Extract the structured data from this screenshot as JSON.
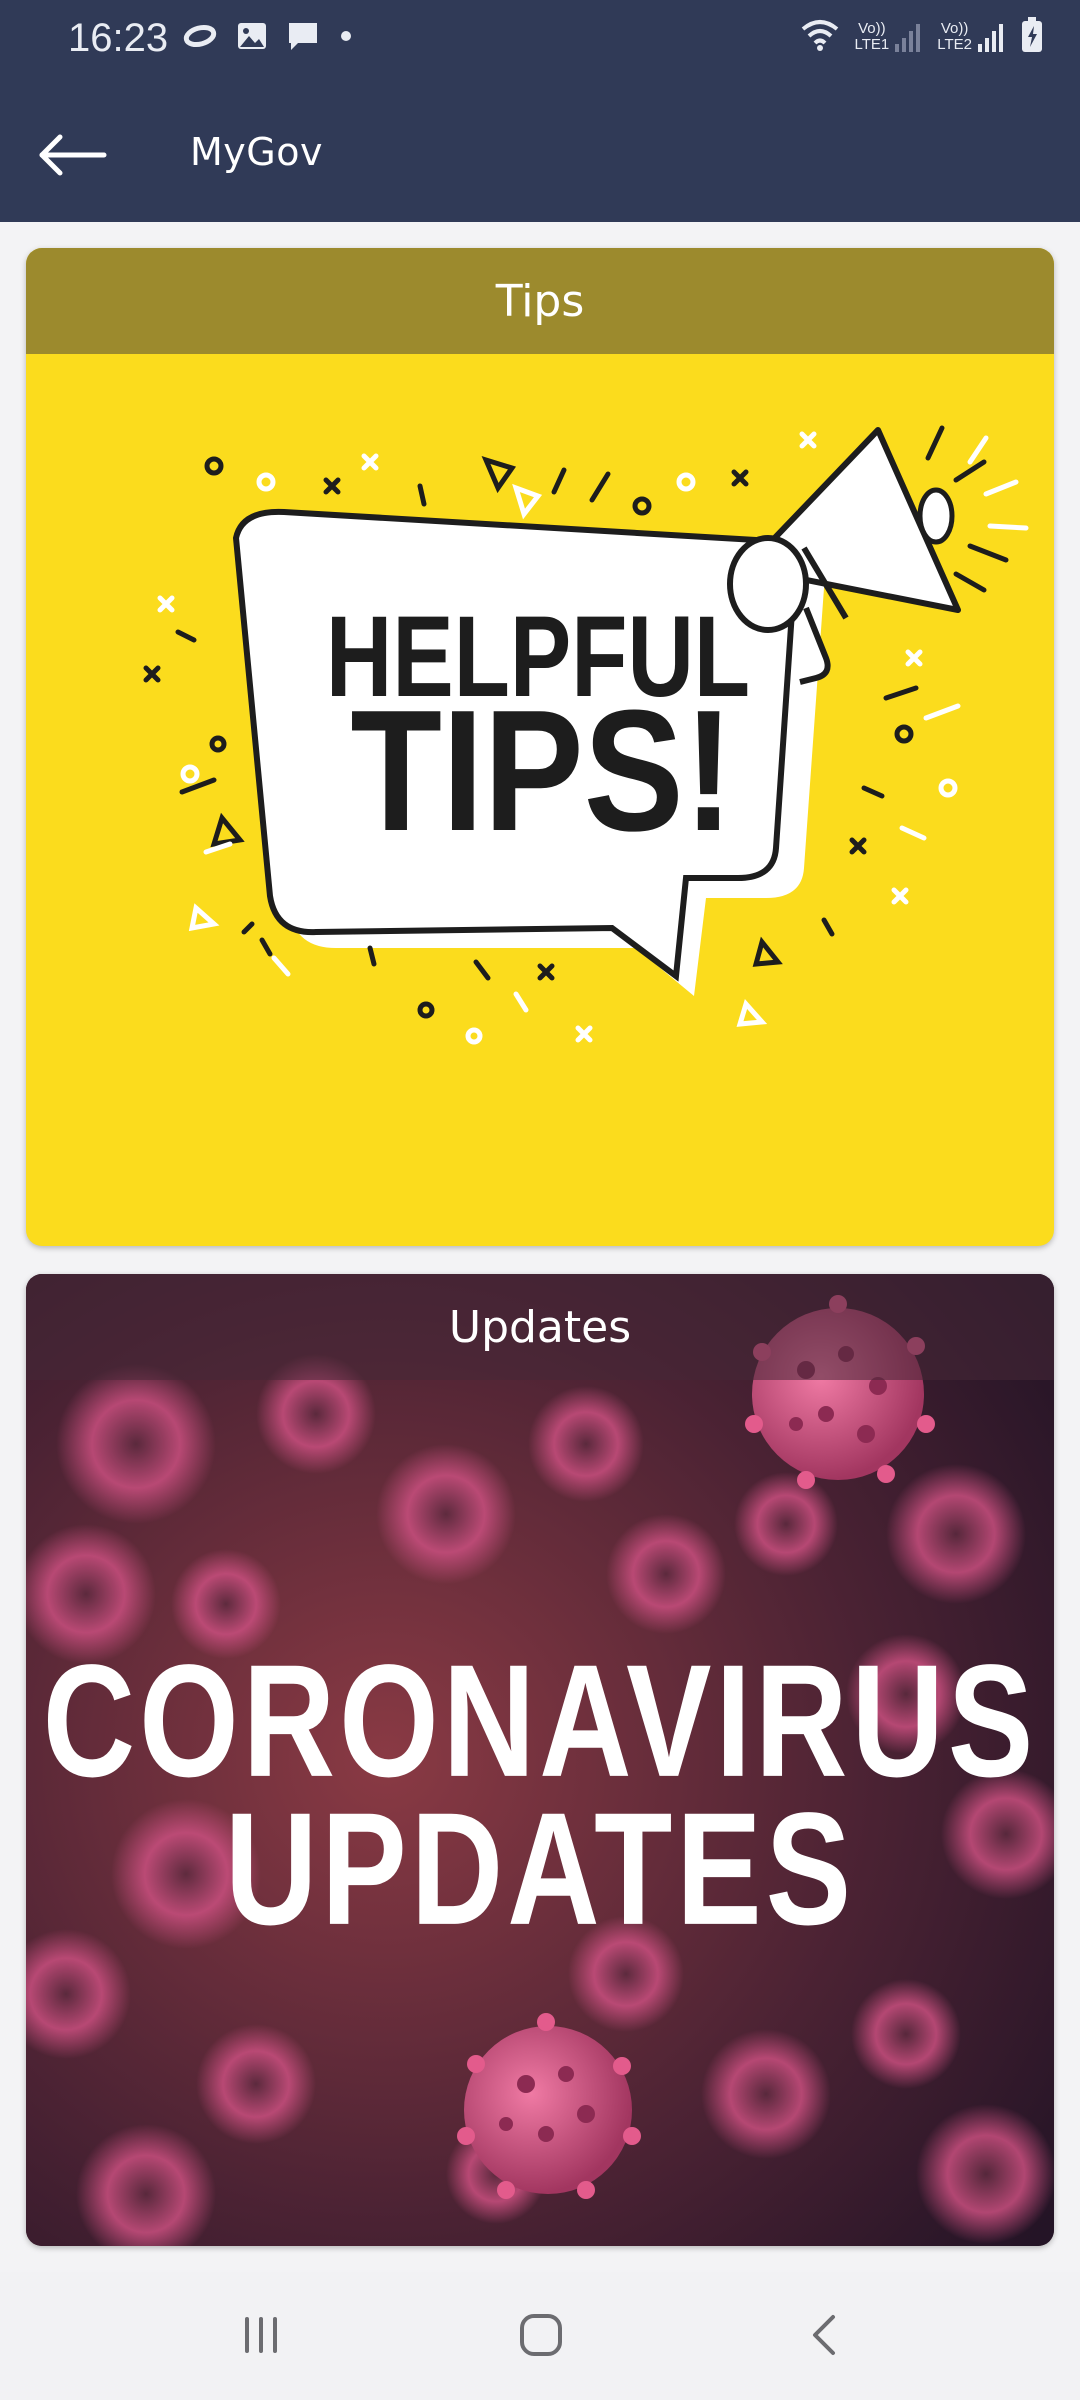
{
  "status_bar": {
    "time": "16:23",
    "left_icons": [
      "link-icon",
      "image-icon",
      "message-icon",
      "dot-icon"
    ],
    "right_icons": [
      "wifi-icon",
      "signal-lte1-icon",
      "signal-lte2-icon",
      "battery-charging-icon"
    ],
    "sim1_label_top": "Vo))",
    "sim1_label_bottom": "LTE1",
    "sim2_label_top": "Vo))",
    "sim2_label_bottom": "LTE2"
  },
  "app_bar": {
    "title": "MyGov",
    "back_icon": "arrow-left-icon",
    "background": "#303a57"
  },
  "cards": {
    "tips": {
      "title": "Tips",
      "banner_line1": "HELPFUL",
      "banner_line2": "TIPS!",
      "header_color": "#9c8a2d",
      "background": "#fbdc1d"
    },
    "updates": {
      "title": "Updates",
      "banner_line1": "CORONAVIRUS",
      "banner_line2": "UPDATES",
      "accent": "#d9567f"
    }
  },
  "nav_bar": {
    "buttons": [
      "recent-apps-icon",
      "home-icon",
      "back-chevron-icon"
    ]
  }
}
